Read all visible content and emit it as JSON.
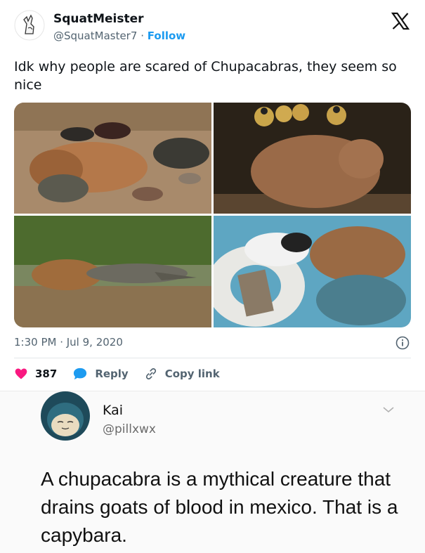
{
  "tweet": {
    "author_name": "SquatMeister",
    "author_handle": "@SquatMaster7",
    "separator": "·",
    "follow_label": "Follow",
    "text": "Idk why people are scared of Chupacabras, they seem so nice",
    "timestamp": "1:30 PM · Jul 9, 2020",
    "likes": "387",
    "reply_label": "Reply",
    "copy_link_label": "Copy link",
    "images": [
      {
        "icon": "capybara-with-ducks-and-turtles-photo"
      },
      {
        "icon": "capybara-with-monkeys-photo"
      },
      {
        "icon": "capybara-with-caiman-photo"
      },
      {
        "icon": "capybara-with-rat-in-pool-photo"
      }
    ]
  },
  "reply": {
    "author_name": "Kai",
    "author_handle": "@pillxwx",
    "text": "A chupacabra is a mythical creature that drains goats of blood in mexico. That is a capybara."
  },
  "colors": {
    "accent": "#1d9bf0",
    "heart": "#f91880",
    "muted": "#536471"
  }
}
